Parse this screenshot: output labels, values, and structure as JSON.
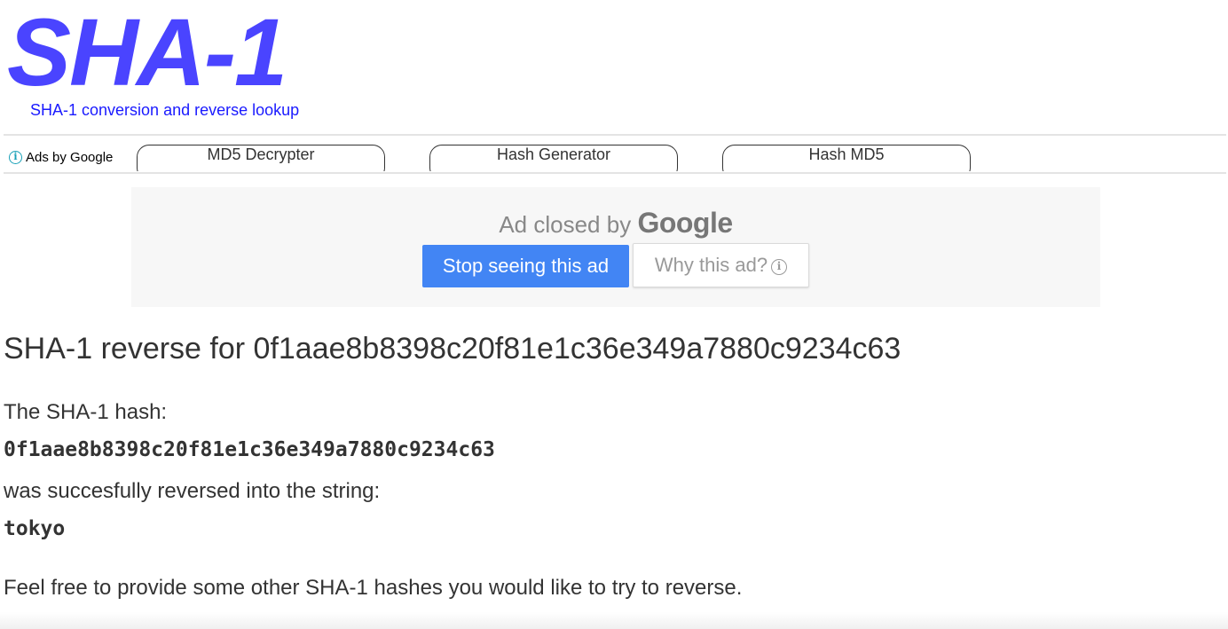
{
  "header": {
    "logo": "SHA-1",
    "subtitle": "SHA-1 conversion and reverse lookup"
  },
  "adsbar": {
    "ads_by_label": "Ads by Google",
    "info_icon": "info-icon",
    "links": [
      "MD5 Decrypter",
      "Hash Generator",
      "Hash MD5"
    ]
  },
  "adbox": {
    "closed_prefix": "Ad closed by",
    "closed_brand": "Google",
    "stop_button": "Stop seeing this ad",
    "why_button": "Why this ad?",
    "why_icon": "info-icon"
  },
  "result": {
    "heading": "SHA-1 reverse for 0f1aae8b8398c20f81e1c36e349a7880c9234c63",
    "intro": "The SHA-1 hash:",
    "hash": "0f1aae8b8398c20f81e1c36e349a7880c9234c63",
    "reversed_text": "was succesfully reversed into the string:",
    "plaintext": "tokyo",
    "footer_text": "Feel free to provide some other SHA-1 hashes you would like to try to reverse."
  },
  "colors": {
    "logo": "#4a44ff",
    "subtitle_link": "#1a1aff",
    "stop_button_bg": "#4285f4",
    "info_icon": "#1aa1b8"
  }
}
